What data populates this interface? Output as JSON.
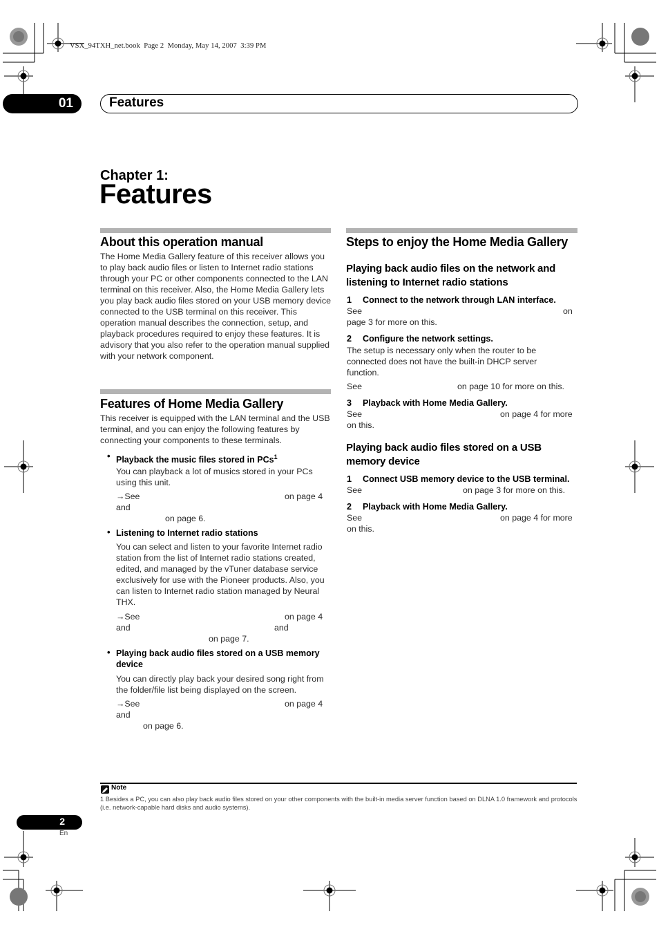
{
  "print_header": "VSX_94TXH_net.book  Page 2  Monday, May 14, 2007  3:39 PM",
  "chapter_tab": {
    "number": "01",
    "title": "Features"
  },
  "chapter": {
    "label": "Chapter 1:",
    "title": "Features"
  },
  "left_column": {
    "about": {
      "heading": "About this operation manual",
      "body": "The Home Media Gallery feature of this receiver allows you to play back audio files or listen to Internet radio stations through your PC or other components connected to the LAN terminal on this receiver. Also, the Home Media Gallery lets you play back audio files stored on your USB memory device connected to the USB terminal on this receiver. This operation manual describes the connection, setup, and playback procedures required to enjoy these features. It is advisory that you also refer to the operation manual supplied with your network component."
    },
    "features": {
      "heading": "Features of Home Media Gallery",
      "intro": "This receiver is equipped with the LAN terminal and the USB terminal, and you can enjoy the following features by connecting your components to these terminals.",
      "items": [
        {
          "title": "Playback the music files stored in PCs",
          "footnote_ref": "1",
          "desc": "You can playback a lot of musics stored in your PCs using this unit.",
          "ref_lines": [
            "→See",
            "on page 4",
            "and",
            "on page 6."
          ]
        },
        {
          "title": "Listening to Internet radio stations",
          "desc": "You can select and listen to your favorite Internet radio station from the list of Internet radio stations created, edited, and managed by the vTuner database service exclusively for use with the Pioneer products. Also, you can listen to Internet radio station managed by Neural THX.",
          "ref_lines": [
            "→See",
            "on page 4",
            "and",
            "and",
            "on page 7."
          ]
        },
        {
          "title": "Playing back audio files stored on a USB memory device",
          "desc": "You can directly play back your desired song right from the folder/file list being displayed on the screen.",
          "ref_lines": [
            "→See",
            "on page 4",
            "and",
            "on page 6."
          ]
        }
      ]
    }
  },
  "right_column": {
    "heading": "Steps to enjoy the Home Media Gallery",
    "network": {
      "heading": "Playing back audio files on the network and listening to Internet radio stations",
      "steps": [
        {
          "num": "1",
          "title": "Connect to the network through LAN interface.",
          "see": "See",
          "ref": "on",
          "tail": "page 3 for more on this."
        },
        {
          "num": "2",
          "title": "Configure the network settings.",
          "desc": "The setup is necessary only when the router to be connected does not have the built-in DHCP server function.",
          "see": "See",
          "ref": "on page 10 for more on this."
        },
        {
          "num": "3",
          "title": "Playback with Home Media Gallery.",
          "see": "See",
          "ref": "on page 4 for more",
          "tail": "on this."
        }
      ]
    },
    "usb": {
      "heading": "Playing back audio files stored on a USB memory device",
      "steps": [
        {
          "num": "1",
          "title": "Connect USB memory device to the USB terminal.",
          "see": "See",
          "ref": "on page 3 for more on this."
        },
        {
          "num": "2",
          "title": "Playback with Home Media Gallery.",
          "see": "See",
          "ref": "on page 4 for more",
          "tail": "on this."
        }
      ]
    }
  },
  "note": {
    "label": "Note",
    "text": "1 Besides a PC, you can also play back audio files stored on your other components with the built-in media server function based on DLNA 1.0 framework and protocols (i.e. network-capable hard disks and audio systems)."
  },
  "footer": {
    "page_number": "2",
    "language": "En"
  }
}
